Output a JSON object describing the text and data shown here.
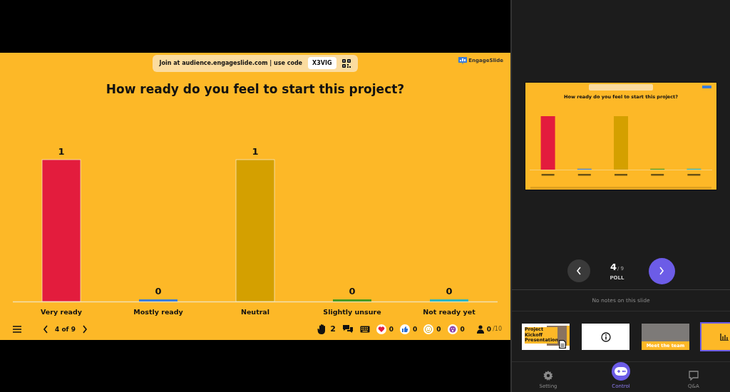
{
  "slide": {
    "join_text": "Join at audience.engageslide.com | use code",
    "code": "X3VIG",
    "logo": "EngageSlide",
    "question": "How ready do you feel to start this project?",
    "chart_data": {
      "type": "bar",
      "categories": [
        "Very ready",
        "Mostly ready",
        "Neutral",
        "Slightly unsure",
        "Not ready yet"
      ],
      "series": [
        {
          "values": [
            1,
            0,
            1,
            0,
            0
          ]
        }
      ],
      "data_labels": true
    },
    "bars": [
      {
        "color": "#e31c3d"
      },
      {
        "color": "#3b7dd8"
      },
      {
        "color": "#d4a000"
      },
      {
        "color": "#4a9a1e"
      },
      {
        "color": "#2bb5c0"
      }
    ],
    "footer": {
      "page": "4 of 9",
      "hands": "2",
      "reactions": [
        {
          "kind": "heart",
          "count": "0"
        },
        {
          "kind": "like",
          "count": "0"
        },
        {
          "kind": "smile",
          "count": "0"
        },
        {
          "kind": "wow",
          "count": "0"
        }
      ],
      "participants": "0",
      "capacity": "/10"
    }
  },
  "preview": {
    "question": "How ready do you feel to start this project?"
  },
  "presenter": {
    "current": "4",
    "total": "/ 9",
    "type": "POLL"
  },
  "notes": "No notes on this slide",
  "thumbnails": [
    {
      "kind": "title",
      "title": "Project Kickoff Presentation",
      "selected": false
    },
    {
      "kind": "info",
      "selected": false
    },
    {
      "kind": "photo",
      "caption": "Meet the team",
      "selected": false
    },
    {
      "kind": "poll",
      "selected": true
    }
  ],
  "bottom_nav": [
    {
      "kind": "gear",
      "label": "Setting",
      "selected": false
    },
    {
      "kind": "control",
      "label": "Control",
      "selected": true
    },
    {
      "kind": "chat",
      "label": "Q&A",
      "selected": false
    }
  ]
}
